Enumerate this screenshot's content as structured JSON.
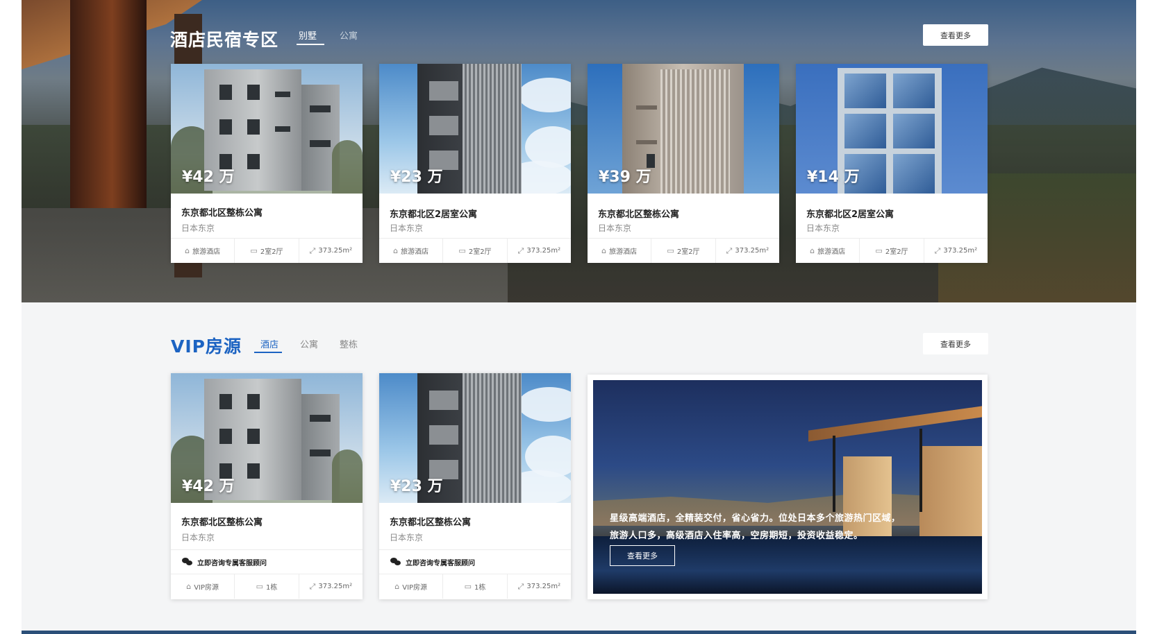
{
  "hotel_section": {
    "title": "酒店民宿专区",
    "tabs": [
      {
        "label": "别墅"
      },
      {
        "label": "公寓"
      }
    ],
    "more_label": "查看更多",
    "cards": [
      {
        "price": "¥42 万",
        "name": "东京都北区整栋公寓",
        "location": "日本东京",
        "type": "旅游酒店",
        "layout": "2室2厅",
        "area": "373.25m²"
      },
      {
        "price": "¥23 万",
        "name": "东京都北区2居室公寓",
        "location": "日本东京",
        "type": "旅游酒店",
        "layout": "2室2厅",
        "area": "373.25m²"
      },
      {
        "price": "¥39 万",
        "name": "东京都北区整栋公寓",
        "location": "日本东京",
        "type": "旅游酒店",
        "layout": "2室2厅",
        "area": "373.25m²"
      },
      {
        "price": "¥14 万",
        "name": "东京都北区2居室公寓",
        "location": "日本东京",
        "type": "旅游酒店",
        "layout": "2室2厅",
        "area": "373.25m²"
      }
    ]
  },
  "vip_section": {
    "title": "VIP房源",
    "tabs": [
      {
        "label": "酒店"
      },
      {
        "label": "公寓"
      },
      {
        "label": "整栋"
      }
    ],
    "more_label": "查看更多",
    "cards": [
      {
        "price": "¥42 万",
        "name": "东京都北区整栋公寓",
        "location": "日本东京",
        "consult": "立即咨询专属客服顾问",
        "type": "VIP房源",
        "units": "1栋",
        "area": "373.25m²"
      },
      {
        "price": "¥23 万",
        "name": "东京都北区整栋公寓",
        "location": "日本东京",
        "consult": "立即咨询专属客服顾问",
        "type": "VIP房源",
        "units": "1栋",
        "area": "373.25m²"
      }
    ],
    "promo": {
      "line1": "星级高端酒店，全精装交付，省心省力。位处日本多个旅游热门区域，",
      "line2": "旅游人口多，高级酒店入住率高，空房期短，投资收益稳定。",
      "button": "查看更多"
    }
  },
  "icons": {
    "type": "home-icon",
    "layout": "bed-icon",
    "area": "area-icon",
    "consult": "wechat-icon"
  }
}
